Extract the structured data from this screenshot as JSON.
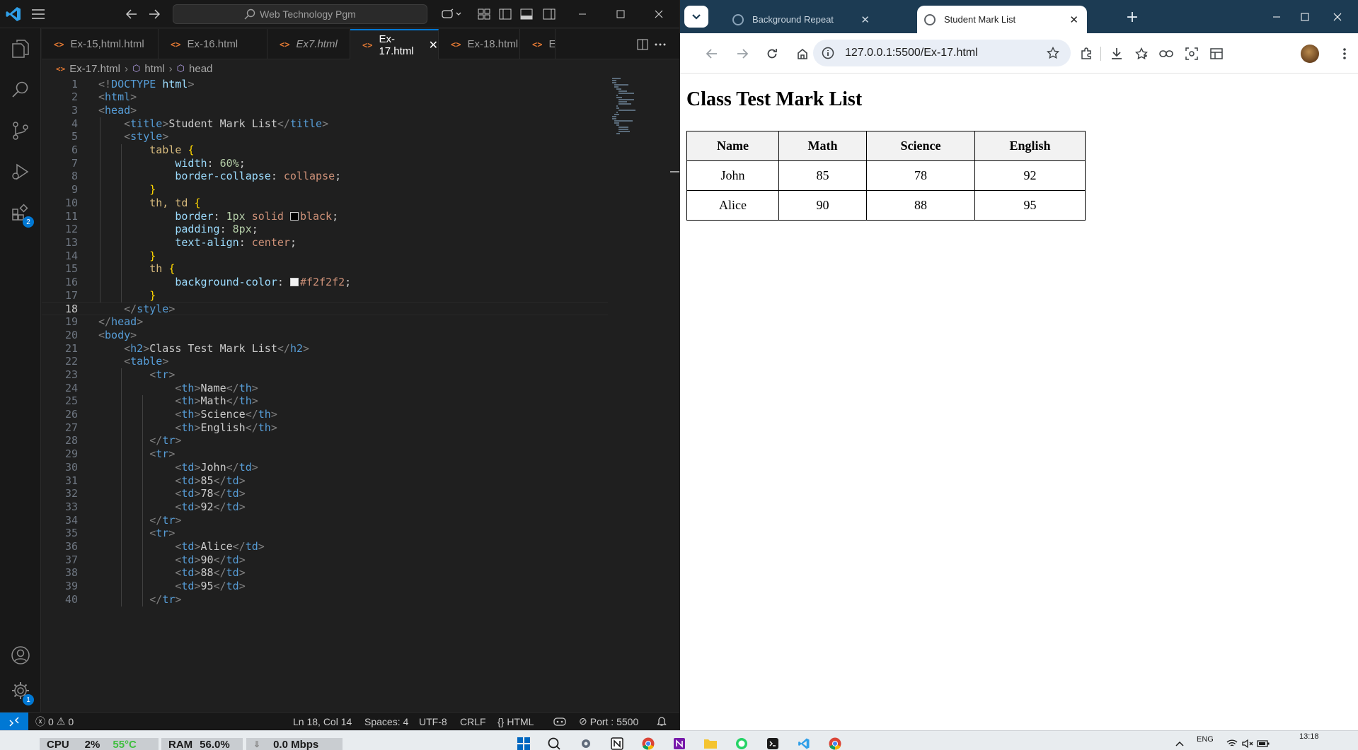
{
  "vscode": {
    "search_text": "Web Technology Pgm",
    "tabs": [
      {
        "label": "Ex-15,html.html",
        "active": false
      },
      {
        "label": "Ex-16.html",
        "active": false
      },
      {
        "label": "Ex7.html",
        "active": false
      },
      {
        "label": "Ex-17.html",
        "active": true
      },
      {
        "label": "Ex-18.html",
        "active": false
      },
      {
        "label": "Ex-",
        "active": false
      }
    ],
    "breadcrumb": [
      "Ex-17.html",
      "html",
      "head"
    ],
    "activity_badges": {
      "extensions": "2",
      "manage": "1"
    },
    "current_line": 18,
    "code_lines": [
      "<!DOCTYPE html>",
      "<html>",
      "<head>",
      "    <title>Student Mark List</title>",
      "    <style>",
      "        table {",
      "            width: 60%;",
      "            border-collapse: collapse;",
      "        }",
      "        th, td {",
      "            border: 1px solid black;",
      "            padding: 8px;",
      "            text-align: center;",
      "        }",
      "        th {",
      "            background-color: #f2f2f2;",
      "        }",
      "    </style>",
      "</head>",
      "<body>",
      "    <h2>Class Test Mark List</h2>",
      "    <table>",
      "        <tr>",
      "            <th>Name</th>",
      "            <th>Math</th>",
      "            <th>Science</th>",
      "            <th>English</th>",
      "        </tr>",
      "        <tr>",
      "            <td>John</td>",
      "            <td>85</td>",
      "            <td>78</td>",
      "            <td>92</td>",
      "        </tr>",
      "        <tr>",
      "            <td>Alice</td>",
      "            <td>90</td>",
      "            <td>88</td>",
      "            <td>95</td>",
      "        </tr>"
    ],
    "status": {
      "errors": "0",
      "warnings": "0",
      "position": "Ln 18, Col 14",
      "spaces": "Spaces: 4",
      "encoding": "UTF-8",
      "eol": "CRLF",
      "language": "HTML",
      "port": "Port : 5500"
    }
  },
  "chrome": {
    "tabs": [
      {
        "title": "Background Repeat",
        "active": false
      },
      {
        "title": "Student Mark List",
        "active": true
      }
    ],
    "url": "127.0.0.1:5500/Ex-17.html",
    "page": {
      "heading": "Class Test Mark List",
      "table": {
        "headers": [
          "Name",
          "Math",
          "Science",
          "English"
        ],
        "rows": [
          [
            "John",
            "85",
            "78",
            "92"
          ],
          [
            "Alice",
            "90",
            "88",
            "95"
          ]
        ]
      }
    }
  },
  "taskbar": {
    "cpu_label": "CPU",
    "cpu_value": "2%",
    "cpu_temp": "55°C",
    "ram_label": "RAM",
    "ram_value": "56.0%",
    "net_value": "0.0 Mbps",
    "language": "ENG",
    "time": "13:18"
  },
  "colors": {
    "vscode_bg": "#1f1f1f",
    "vscode_accent": "#0078d4",
    "chrome_tabstrip": "#1c3b53",
    "th_background": "#f2f2f2"
  }
}
